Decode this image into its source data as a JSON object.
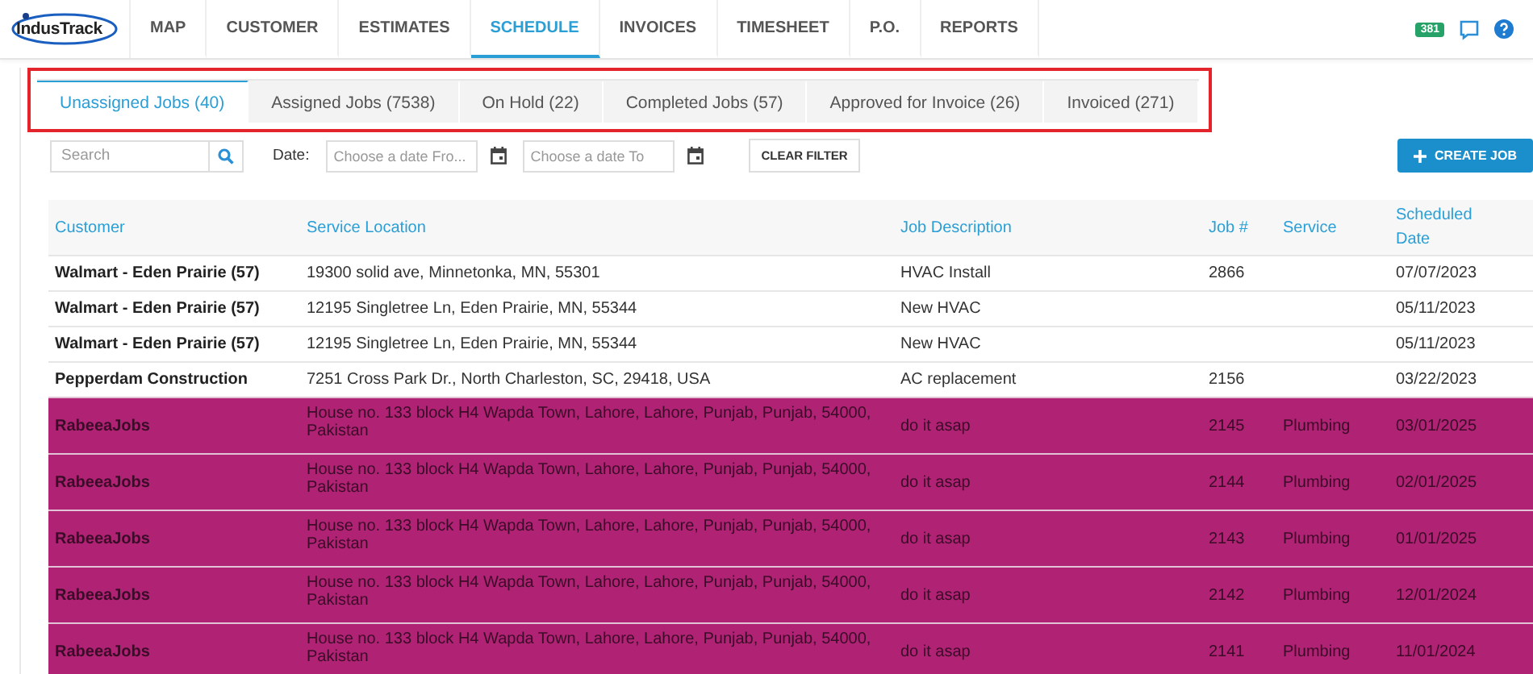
{
  "logo": {
    "text": "IndusTrack"
  },
  "nav": [
    {
      "label": "MAP",
      "selected": false
    },
    {
      "label": "CUSTOMER",
      "selected": false
    },
    {
      "label": "ESTIMATES",
      "selected": false
    },
    {
      "label": "SCHEDULE",
      "selected": true
    },
    {
      "label": "INVOICES",
      "selected": false
    },
    {
      "label": "TIMESHEET",
      "selected": false
    },
    {
      "label": "P.O.",
      "selected": false
    },
    {
      "label": "REPORTS",
      "selected": false
    }
  ],
  "notifications": {
    "count": "381"
  },
  "tabs_highlighted": true,
  "tabs": [
    {
      "label": "Unassigned Jobs (40)",
      "selected": true
    },
    {
      "label": "Assigned Jobs (7538)",
      "selected": false
    },
    {
      "label": "On Hold (22)",
      "selected": false
    },
    {
      "label": "Completed Jobs (57)",
      "selected": false
    },
    {
      "label": "Approved for Invoice (26)",
      "selected": false
    },
    {
      "label": "Invoiced (271)",
      "selected": false
    }
  ],
  "filters": {
    "search": {
      "placeholder": "Search"
    },
    "date_label": "Date:",
    "date_from": {
      "placeholder": "Choose a date Fro..."
    },
    "date_to": {
      "placeholder": "Choose a date To"
    },
    "clear_button": "CLEAR FILTER"
  },
  "create_button": "CREATE JOB",
  "table": {
    "columns": [
      "Customer",
      "Service Location",
      "Job Description",
      "Job #",
      "Service",
      "Scheduled Date"
    ],
    "rows": [
      {
        "color": "#ffffff",
        "cells": [
          "Walmart - Eden Prairie (57)",
          "19300 solid ave, Minnetonka, MN, 55301",
          "HVAC Install",
          "2866",
          "",
          "07/07/2023"
        ]
      },
      {
        "color": "#ffffff",
        "cells": [
          "Walmart - Eden Prairie (57)",
          "12195 Singletree Ln, Eden Prairie, MN, 55344",
          "New HVAC",
          "",
          "",
          "05/11/2023"
        ]
      },
      {
        "color": "#ffffff",
        "cells": [
          "Walmart - Eden Prairie (57)",
          "12195 Singletree Ln, Eden Prairie, MN, 55344",
          "New HVAC",
          "",
          "",
          "05/11/2023"
        ]
      },
      {
        "color": "#ffffff",
        "cells": [
          "Pepperdam Construction",
          "7251 Cross Park Dr., North Charleston, SC, 29418, USA",
          "AC replacement",
          "2156",
          "",
          "03/22/2023"
        ]
      },
      {
        "color": "#b02273",
        "cells": [
          "RabeeaJobs",
          "House no. 133 block H4 Wapda Town, Lahore, Lahore, Punjab, Punjab, 54000, Pakistan",
          "do it asap",
          "2145",
          "Plumbing",
          "03/01/2025"
        ]
      },
      {
        "color": "#b02273",
        "cells": [
          "RabeeaJobs",
          "House no. 133 block H4 Wapda Town, Lahore, Lahore, Punjab, Punjab, 54000, Pakistan",
          "do it asap",
          "2144",
          "Plumbing",
          "02/01/2025"
        ]
      },
      {
        "color": "#b02273",
        "cells": [
          "RabeeaJobs",
          "House no. 133 block H4 Wapda Town, Lahore, Lahore, Punjab, Punjab, 54000, Pakistan",
          "do it asap",
          "2143",
          "Plumbing",
          "01/01/2025"
        ]
      },
      {
        "color": "#b02273",
        "cells": [
          "RabeeaJobs",
          "House no. 133 block H4 Wapda Town, Lahore, Lahore, Punjab, Punjab, 54000, Pakistan",
          "do it asap",
          "2142",
          "Plumbing",
          "12/01/2024"
        ]
      },
      {
        "color": "#b02273",
        "cells": [
          "RabeeaJobs",
          "House no. 133 block H4 Wapda Town, Lahore, Lahore, Punjab, Punjab, 54000, Pakistan",
          "do it asap",
          "2141",
          "Plumbing",
          "11/01/2024"
        ]
      }
    ]
  }
}
